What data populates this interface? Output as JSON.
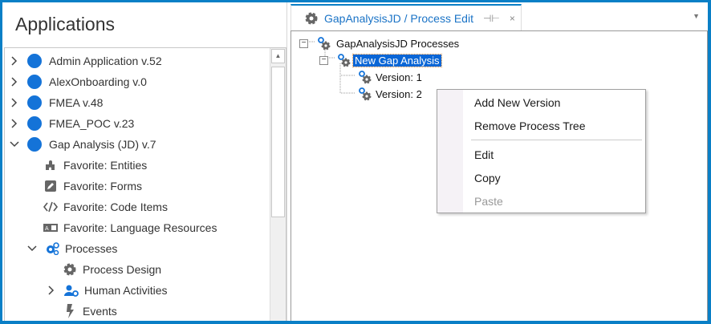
{
  "left": {
    "title": "Applications",
    "apps": [
      {
        "label": "Admin Application v.52",
        "expanded": false
      },
      {
        "label": "AlexOnboarding v.0",
        "expanded": false
      },
      {
        "label": "FMEA v.48",
        "expanded": false
      },
      {
        "label": "FMEA_POC v.23",
        "expanded": false
      },
      {
        "label": "Gap Analysis (JD) v.7",
        "expanded": true
      }
    ],
    "children": [
      {
        "label": "Favorite: Entities",
        "icon": "puzzle-icon"
      },
      {
        "label": "Favorite: Forms",
        "icon": "pencil-icon"
      },
      {
        "label": "Favorite: Code Items",
        "icon": "code-icon"
      },
      {
        "label": "Favorite: Language Resources",
        "icon": "language-icon"
      },
      {
        "label": "Processes",
        "icon": "gears-icon"
      }
    ],
    "process_children": [
      {
        "label": "Process Design",
        "icon": "gear-icon"
      },
      {
        "label": "Human Activities",
        "icon": "user-gear-icon"
      },
      {
        "label": "Events",
        "icon": "lightning-icon"
      }
    ]
  },
  "tab": {
    "label": "GapAnalysisJD / Process Edit",
    "pin": "⊣⊢",
    "close": "×"
  },
  "tree": {
    "root": "GapAnalysisJD Processes",
    "process": "New Gap Analysis",
    "versions": [
      "Version: 1",
      "Version: 2"
    ]
  },
  "context_menu": {
    "items": [
      "Add New Version",
      "Remove Process Tree",
      "Edit",
      "Copy",
      "Paste"
    ]
  },
  "colors": {
    "accent": "#0a7fc6",
    "selection": "#0a66d6",
    "app_dot": "#1473d8"
  }
}
